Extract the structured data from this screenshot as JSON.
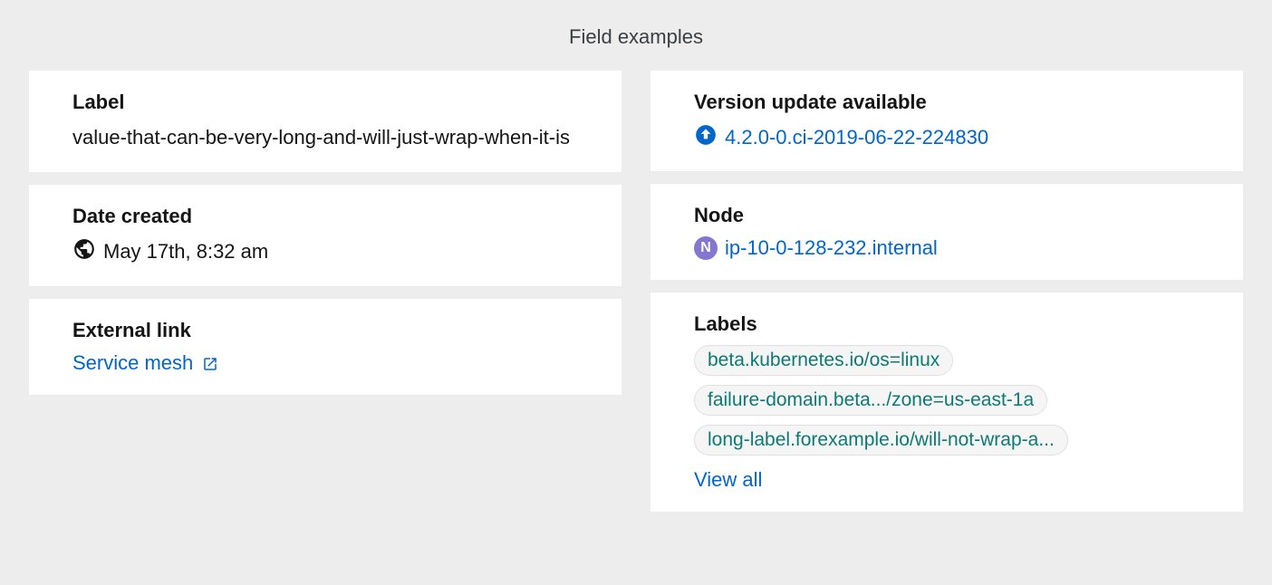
{
  "title": "Field examples",
  "left": {
    "label": {
      "header": "Label",
      "value": "value-that-can-be-very-long-and-will-just-wrap-when-it-is"
    },
    "date_created": {
      "header": "Date created",
      "value": "May 17th, 8:32 am"
    },
    "external_link": {
      "header": "External link",
      "link_text": "Service mesh"
    }
  },
  "right": {
    "version_update": {
      "header": "Version update available",
      "link_text": "4.2.0-0.ci-2019-06-22-224830"
    },
    "node": {
      "header": "Node",
      "badge_letter": "N",
      "link_text": "ip-10-0-128-232.internal"
    },
    "labels": {
      "header": "Labels",
      "chips": [
        "beta.kubernetes.io/os=linux",
        "failure-domain.beta.../zone=us-east-1a",
        "long-label.forexample.io/will-not-wrap-a..."
      ],
      "view_all": "View all"
    }
  }
}
